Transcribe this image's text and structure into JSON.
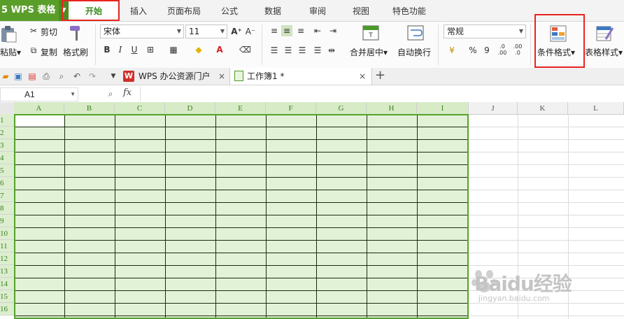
{
  "app": {
    "title": "WPS 表格"
  },
  "menu_tabs": [
    "开始",
    "插入",
    "页面布局",
    "公式",
    "数据",
    "审阅",
    "视图",
    "特色功能"
  ],
  "ribbon": {
    "paste_label": "粘贴",
    "cut_label": "剪切",
    "copy_label": "复制",
    "format_painter_label": "格式刷",
    "font_name": "宋体",
    "font_size": "11",
    "bold": "B",
    "italic": "I",
    "underline": "U",
    "merge_center_label": "合并居中",
    "wrap_text_label": "自动换行",
    "number_format": "常规",
    "percent": "%",
    "comma": "9",
    "conditional_format_label": "条件格式",
    "table_style_label": "表格样式"
  },
  "doc_tabs": [
    {
      "label": "WPS 办公资源门户"
    },
    {
      "label": "工作簿1 *"
    }
  ],
  "formula_bar": {
    "cell_ref": "A1",
    "fx": "fx"
  },
  "columns": [
    "A",
    "B",
    "C",
    "D",
    "E",
    "F",
    "G",
    "H",
    "I",
    "J",
    "K",
    "L"
  ],
  "rows": [
    "1",
    "2",
    "3",
    "4",
    "5",
    "6",
    "7",
    "8",
    "9",
    "10",
    "11",
    "12",
    "13",
    "14",
    "15",
    "16"
  ],
  "watermark": {
    "brand": "Baidu经验",
    "url": "jingyan.baidu.com"
  },
  "colors": {
    "accent": "#5a9e2a",
    "selection_fill": "#e2f2d7",
    "highlight_box": "#e8241f"
  }
}
